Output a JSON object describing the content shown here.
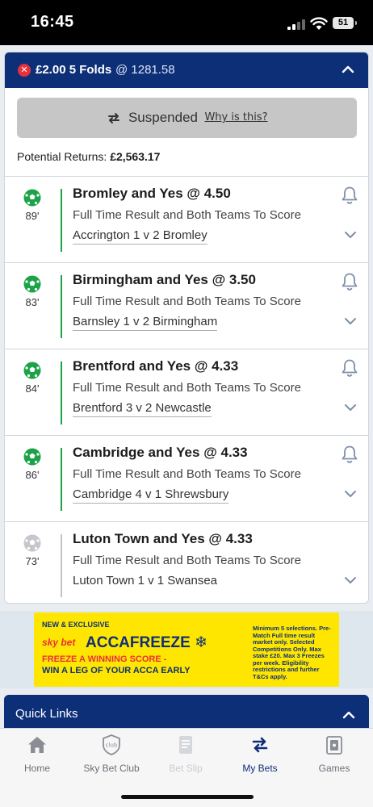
{
  "status_bar": {
    "time": "16:45",
    "battery": "51"
  },
  "bet": {
    "stake": "£2.00 5 Folds",
    "odds": "@ 1281.58",
    "suspended_label": "Suspended",
    "why_link": "Why is this?",
    "returns_label": "Potential Returns:",
    "returns_value": "£2,563.17",
    "legs": [
      {
        "minute": "89'",
        "selection": "Bromley and Yes @ 4.50",
        "market": "Full Time Result and Both Teams To Score",
        "event": "Accrington 1 v 2 Bromley",
        "status": "winning"
      },
      {
        "minute": "83'",
        "selection": "Birmingham and Yes @ 3.50",
        "market": "Full Time Result and Both Teams To Score",
        "event": "Barnsley 1 v 2 Birmingham",
        "status": "winning"
      },
      {
        "minute": "84'",
        "selection": "Brentford and Yes @ 4.33",
        "market": "Full Time Result and Both Teams To Score",
        "event": "Brentford 3 v 2 Newcastle",
        "status": "winning"
      },
      {
        "minute": "86'",
        "selection": "Cambridge and Yes @ 4.33",
        "market": "Full Time Result and Both Teams To Score",
        "event": "Cambridge 4 v 1 Shrewsbury",
        "status": "winning"
      },
      {
        "minute": "73'",
        "selection": "Luton Town and Yes @ 4.33",
        "market": "Full Time Result and Both Teams To Score",
        "event": "Luton Town 1 v 1 Swansea",
        "status": "not-winning"
      }
    ]
  },
  "promo": {
    "tag": "NEW & EXCLUSIVE",
    "brand": "sky bet",
    "title": "ACCAFREEZE",
    "line1": "FREEZE A WINNING SCORE -",
    "line2": "WIN A LEG OF YOUR ACCA EARLY",
    "terms": "Minimum 5 selections. Pre-Match Full time result market only. Selected Competitions Only. Max stake £20. Max 3 Freezes per week. Eligibility restrictions and further T&Cs apply."
  },
  "quick_links": {
    "title": "Quick Links"
  },
  "tabs": [
    {
      "label": "Home",
      "icon": "home-icon",
      "state": "normal"
    },
    {
      "label": "Sky Bet Club",
      "icon": "club-icon",
      "state": "normal"
    },
    {
      "label": "Bet Slip",
      "icon": "betslip-icon",
      "state": "disabled"
    },
    {
      "label": "My Bets",
      "icon": "mybets-icon",
      "state": "active"
    },
    {
      "label": "Games",
      "icon": "games-icon",
      "state": "normal"
    }
  ],
  "colors": {
    "navy": "#0d2f78",
    "green": "#1aa347",
    "red": "#e8313a",
    "promo_yellow": "#ffe600"
  }
}
